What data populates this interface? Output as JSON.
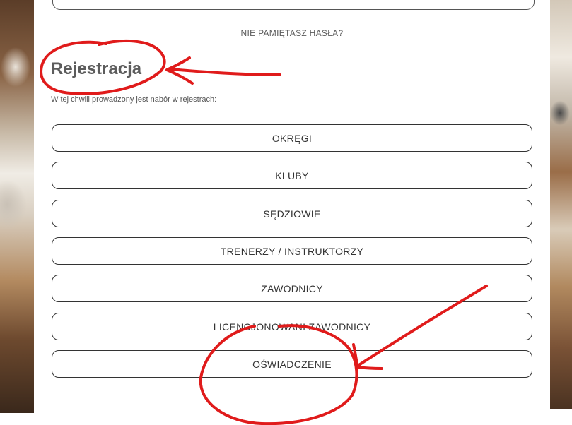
{
  "login": {
    "forgot_password": "NIE PAMIĘTASZ HASŁA?"
  },
  "registration": {
    "title": "Rejestracja",
    "note": "W tej chwili prowadzony jest nabór w rejestrach:",
    "buttons": [
      "OKRĘGI",
      "KLUBY",
      "SĘDZIOWIE",
      "TRENERZY / INSTRUKTORZY",
      "ZAWODNICY",
      "LICENCJONOWANI ZAWODNICY",
      "OŚWIADCZENIE"
    ]
  },
  "annotation_color": "#e01b1b"
}
